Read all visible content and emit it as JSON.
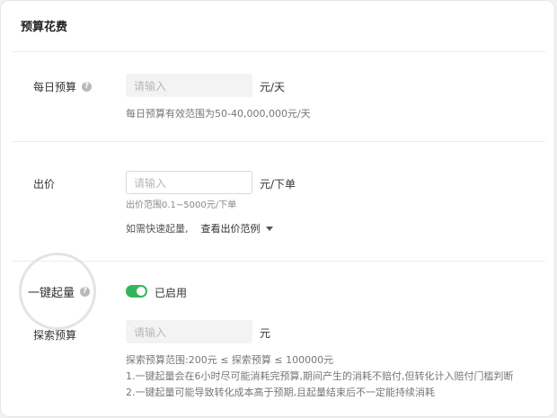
{
  "section": {
    "title": "预算花费"
  },
  "daily_budget": {
    "label": "每日预算",
    "placeholder": "请输入",
    "unit": "元/天",
    "hint": "每日预算有效范围为50-40,000,000元/天"
  },
  "bid": {
    "label": "出价",
    "placeholder": "请输入",
    "unit": "元/下单",
    "range_hint": "出价范围0.1~5000元/下单",
    "quick_prefix": "如需快速起量,",
    "example_link": "查看出价范例"
  },
  "one_click": {
    "label": "一键起量",
    "status": "已启用",
    "enabled": true
  },
  "explore_budget": {
    "label": "探索预算",
    "placeholder": "请输入",
    "unit": "元",
    "range": "探索预算范围:200元 ≤ 探索预算 ≤ 100000元",
    "note1": "1.一键起量会在6小时尽可能消耗完预算,期间产生的消耗不赔付,但转化计入赔付门槛判断",
    "note2": "2.一键起量可能导致转化成本高于预期,且起量结束后不一定能持续消耗"
  },
  "colors": {
    "toggle_on": "#35b45e"
  },
  "icons": {
    "help": "question-circle-icon",
    "dropdown": "caret-down-icon"
  }
}
